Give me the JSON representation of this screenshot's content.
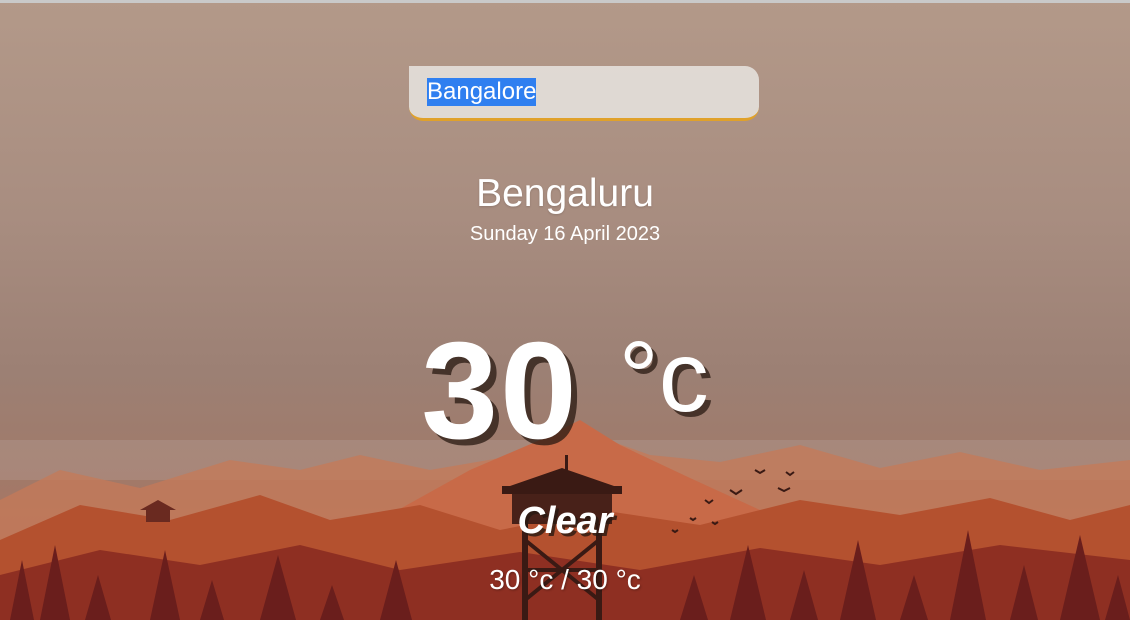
{
  "search": {
    "value": "Bangalore",
    "placeholder": ""
  },
  "location": {
    "city": "Bengaluru",
    "date": "Sunday 16 April 2023"
  },
  "current": {
    "temperature": "30",
    "unit": "°c",
    "condition": "Clear",
    "hi_lo": "30 °c / 30 °c"
  },
  "colors": {
    "accent": "#e0a12a",
    "selection": "#2f7ff0",
    "text": "#ffffff"
  }
}
